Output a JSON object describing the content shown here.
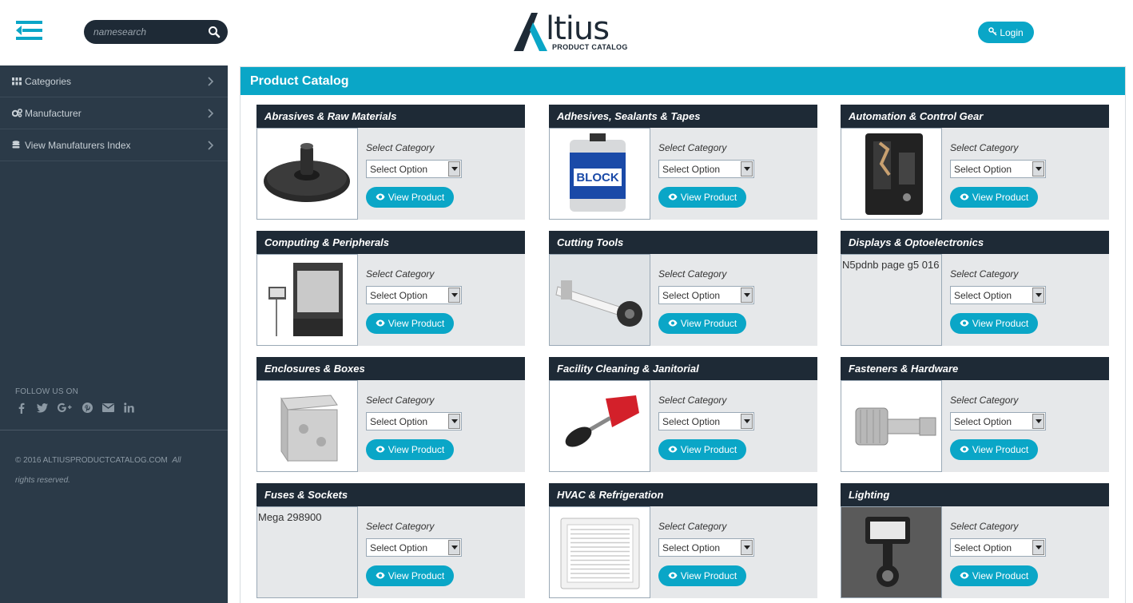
{
  "header": {
    "search": {
      "placeholder": "namesearch",
      "value": ""
    },
    "logo": {
      "wordmark": "ltius",
      "subtitle": "PRODUCT CATALOG"
    },
    "login_label": "Login"
  },
  "sidebar": {
    "items": [
      {
        "label": "Categories",
        "icon": "grid-icon"
      },
      {
        "label": "Manufacturer",
        "icon": "gears-icon"
      },
      {
        "label": "View Manufaturers Index",
        "icon": "database-icon"
      }
    ],
    "follow_label": "FOLLOW US ON",
    "social": [
      "facebook-icon",
      "twitter-icon",
      "google-plus-icon",
      "pinterest-icon",
      "email-icon",
      "linkedin-icon"
    ],
    "copyright": "© 2016 ALTIUSPRODUCTCATALOG.COM",
    "rights": "All rights reserved."
  },
  "main": {
    "title": "Product Catalog",
    "select_label": "Select Category",
    "select_value": "Select Option",
    "view_label": "View Product",
    "cards": [
      {
        "title": "Abrasives & Raw Materials",
        "image": "abrasive-disc",
        "alt_text": ""
      },
      {
        "title": "Adhesives, Sealants & Tapes",
        "image": "sealant-can",
        "alt_text": ""
      },
      {
        "title": "Automation & Control Gear",
        "image": "control-relay",
        "alt_text": ""
      },
      {
        "title": "Computing & Peripherals",
        "image": "3d-printer",
        "alt_text": ""
      },
      {
        "title": "Cutting Tools",
        "image": "cutting-tool",
        "alt_text": ""
      },
      {
        "title": "Displays & Optoelectronics",
        "image": "",
        "alt_text": "N5pdnb page g5 016"
      },
      {
        "title": "Enclosures & Boxes",
        "image": "metal-box",
        "alt_text": ""
      },
      {
        "title": "Facility Cleaning & Janitorial",
        "image": "cleaning-brush",
        "alt_text": ""
      },
      {
        "title": "Fasteners & Hardware",
        "image": "thumb-screw",
        "alt_text": ""
      },
      {
        "title": "Fuses & Sockets",
        "image": "",
        "alt_text": "Mega 298900"
      },
      {
        "title": "HVAC & Refrigeration",
        "image": "air-vent",
        "alt_text": ""
      },
      {
        "title": "Lighting",
        "image": "security-light",
        "alt_text": ""
      }
    ]
  },
  "colors": {
    "accent": "#0aa6c7",
    "dark": "#1e2a36",
    "sidebar": "#2b3a48",
    "card_bg": "#e6e8ea"
  }
}
